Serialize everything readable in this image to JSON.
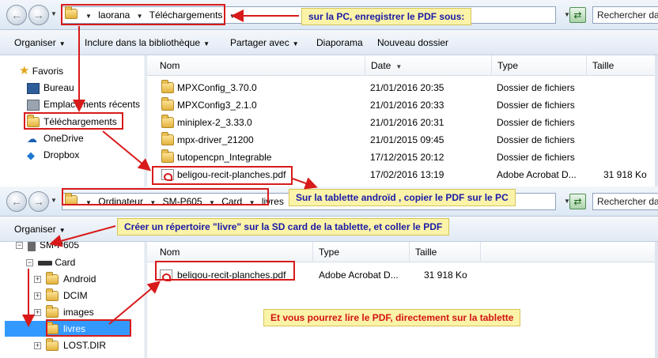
{
  "window_top": {
    "address": {
      "crumbs": [
        "laorana",
        "Téléchargements"
      ],
      "search_placeholder": "Rechercher dans"
    },
    "toolbar": {
      "organize": "Organiser",
      "include": "Inclure dans la bibliothèque",
      "share": "Partager avec",
      "slideshow": "Diaporama",
      "new_folder": "Nouveau dossier"
    },
    "nav": {
      "favorites": "Favoris",
      "desktop": "Bureau",
      "recent": "Emplacements récents",
      "downloads": "Téléchargements",
      "onedrive": "OneDrive",
      "dropbox": "Dropbox"
    },
    "columns": {
      "name": "Nom",
      "date": "Date",
      "type": "Type",
      "size": "Taille"
    },
    "files": [
      {
        "name": "MPXConfig_3.70.0",
        "date": "21/01/2016 20:35",
        "type": "Dossier de fichiers",
        "size": ""
      },
      {
        "name": "MPXConfig3_2.1.0",
        "date": "21/01/2016 20:33",
        "type": "Dossier de fichiers",
        "size": ""
      },
      {
        "name": "miniplex-2_3.33.0",
        "date": "21/01/2016 20:31",
        "type": "Dossier de fichiers",
        "size": ""
      },
      {
        "name": "mpx-driver_21200",
        "date": "21/01/2015 09:45",
        "type": "Dossier de fichiers",
        "size": ""
      },
      {
        "name": "tutopencpn_Integrable",
        "date": "17/12/2015 20:12",
        "type": "Dossier de fichiers",
        "size": ""
      },
      {
        "name": "beligou-recit-planches.pdf",
        "date": "17/02/2016 13:19",
        "type": "Adobe Acrobat D...",
        "size": "31 918 Ko"
      }
    ]
  },
  "window_bottom": {
    "address": {
      "crumbs": [
        "Ordinateur",
        "SM-P605",
        "Card",
        "livres"
      ],
      "search_placeholder": "Rechercher dans"
    },
    "toolbar": {
      "organize": "Organiser"
    },
    "nav": {
      "device": "SM-P605",
      "card": "Card",
      "folders": [
        "Android",
        "DCIM",
        "images",
        "livres",
        "LOST.DIR"
      ]
    },
    "columns": {
      "name": "Nom",
      "type": "Type",
      "size": "Taille"
    },
    "files": [
      {
        "name": "beligou-recit-planches.pdf",
        "type": "Adobe Acrobat D...",
        "size": "31 918 Ko"
      }
    ]
  },
  "annotations": {
    "pc_save": "sur la PC, enregistrer le PDF sous:",
    "tablet_copy": "Sur la tablette androïd , copier le PDF sur le PC",
    "create_dir": "Créer un répertoire \"livre\" sur la SD card de la tablette, et coller le PDF",
    "read_pdf": "Et vous pourrez lire le PDF, directement sur la tablette"
  },
  "colors": {
    "annotation_red": "#d81a1a",
    "callout_bg": "#fbf3a8",
    "callout_blue_text": "#1a1aa8",
    "selection_blue": "#3399ff"
  }
}
